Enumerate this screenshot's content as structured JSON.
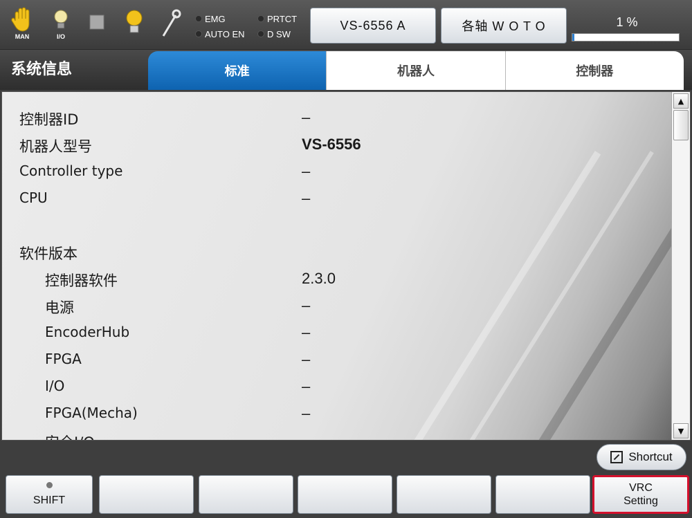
{
  "topbar": {
    "icons": [
      {
        "name": "hand-icon",
        "caption": "MAN"
      },
      {
        "name": "io-bulb-icon",
        "caption": "I/O"
      },
      {
        "name": "square-icon",
        "caption": ""
      },
      {
        "name": "lamp-icon",
        "caption": ""
      },
      {
        "name": "wrench-icon",
        "caption": ""
      }
    ],
    "indicators": {
      "emg": "EMG",
      "prtct": "PRTCT",
      "auto_en": "AUTO EN",
      "dsw": "D SW"
    },
    "robot_button": "VS-6556 A",
    "axis_button": "各轴 W O T O",
    "speed_label": "1 %",
    "speed_fraction": 0.01
  },
  "header": {
    "title": "系统信息",
    "tabs": [
      "标准",
      "机器人",
      "控制器"
    ],
    "active_tab": 0
  },
  "info_rows": [
    {
      "label": "控制器ID",
      "value": "–",
      "indent": false,
      "bold": false
    },
    {
      "label": "机器人型号",
      "value": "VS-6556",
      "indent": false,
      "bold": true
    },
    {
      "label": "Controller type",
      "value": "–",
      "indent": false,
      "bold": false
    },
    {
      "label": "CPU",
      "value": "–",
      "indent": false,
      "bold": false
    },
    {
      "label": "",
      "value": "",
      "indent": false,
      "bold": false
    },
    {
      "label": "软件版本",
      "value": "",
      "indent": false,
      "bold": false
    },
    {
      "label": "控制器软件",
      "value": "2.3.0",
      "indent": true,
      "bold": false
    },
    {
      "label": "电源",
      "value": "–",
      "indent": true,
      "bold": false
    },
    {
      "label": "EncoderHub",
      "value": "–",
      "indent": true,
      "bold": false
    },
    {
      "label": "FPGA",
      "value": "–",
      "indent": true,
      "bold": false
    },
    {
      "label": "I/O",
      "value": "–",
      "indent": true,
      "bold": false
    },
    {
      "label": "FPGA(Mecha)",
      "value": "–",
      "indent": true,
      "bold": false
    },
    {
      "label": "安全I/O",
      "value": "–",
      "indent": true,
      "bold": false
    }
  ],
  "shortcut": {
    "label": "Shortcut"
  },
  "fkeys": {
    "shift": "SHIFT",
    "vrc_line1": "VRC",
    "vrc_line2": "Setting"
  },
  "colors": {
    "tab_active": "#1170c4",
    "highlight_border": "#d4102c",
    "progress_fill": "#2d7fd0"
  }
}
